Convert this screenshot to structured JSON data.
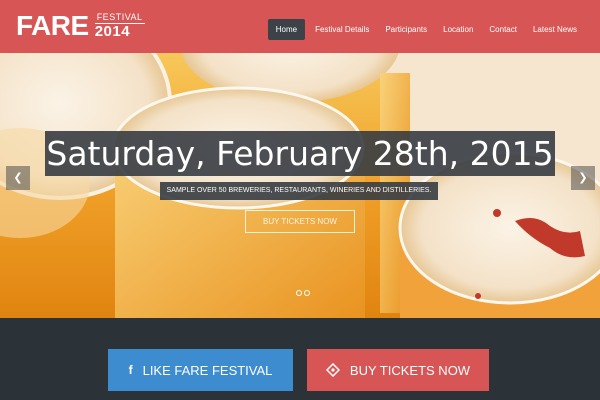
{
  "colors": {
    "header_bg": "#d85555",
    "nav_active_bg": "#3d4249",
    "bottom_bg": "#2b3238",
    "like_button_bg": "#3d8ccf",
    "buy_button_bg": "#d85555"
  },
  "logo": {
    "main": "FARE",
    "festival": "FESTIVAL",
    "year": "2014"
  },
  "nav": {
    "items": [
      {
        "label": "Home",
        "active": true
      },
      {
        "label": "Festival Details",
        "active": false
      },
      {
        "label": "Participants",
        "active": false
      },
      {
        "label": "Location",
        "active": false
      },
      {
        "label": "Contact",
        "active": false
      },
      {
        "label": "Latest News",
        "active": false
      }
    ]
  },
  "hero": {
    "title": "Saturday, February 28th, 2015",
    "subtitle": "SAMPLE OVER 50 BREWERIES, RESTAURANTS, WINERIES AND DISTILLERIES.",
    "button_label": "BUY TICKETS NOW",
    "prev_icon": "chevron-left-icon",
    "next_icon": "chevron-right-icon",
    "slide_count": 2,
    "active_slide": 1
  },
  "actions": {
    "like_label": "LIKE FARE FESTIVAL",
    "like_icon": "facebook-icon",
    "buy_label": "BUY TICKETS NOW",
    "buy_icon": "ticket-icon"
  }
}
